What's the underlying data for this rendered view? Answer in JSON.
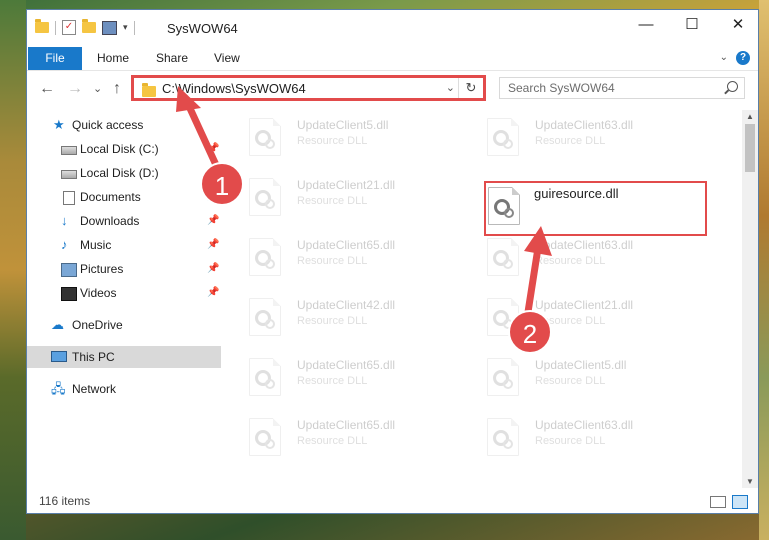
{
  "window": {
    "title": "SysWOW64",
    "controls": {
      "minimize": "—",
      "maximize": "☐",
      "close": "✕"
    }
  },
  "ribbon": {
    "file": "File",
    "tabs": [
      "Home",
      "Share",
      "View"
    ],
    "help": "?"
  },
  "nav": {
    "back": "←",
    "forward": "→",
    "recent": "⌄",
    "up": "↑",
    "address": "C:\\Windows\\SysWOW64",
    "search_placeholder": "Search SysWOW64"
  },
  "sidebar": {
    "items": [
      {
        "label": "Quick access",
        "icon": "star-icon"
      },
      {
        "label": "Local Disk (C:)",
        "icon": "disk-icon",
        "pinned": true
      },
      {
        "label": "Local Disk (D:)",
        "icon": "disk-icon",
        "pinned": true
      },
      {
        "label": "Documents",
        "icon": "document-icon",
        "pinned": true
      },
      {
        "label": "Downloads",
        "icon": "download-icon",
        "pinned": true
      },
      {
        "label": "Music",
        "icon": "music-icon",
        "pinned": true
      },
      {
        "label": "Pictures",
        "icon": "pictures-icon",
        "pinned": true
      },
      {
        "label": "Videos",
        "icon": "video-icon",
        "pinned": true
      },
      {
        "label": "OneDrive",
        "icon": "cloud-icon"
      },
      {
        "label": "This PC",
        "icon": "computer-icon",
        "selected": true
      },
      {
        "label": "Network",
        "icon": "network-icon"
      }
    ]
  },
  "files": {
    "highlighted": {
      "name": "guiresource.dll"
    },
    "left_column": [
      {
        "name": "UpdateClient5.dll",
        "desc": "Resource DLL"
      },
      {
        "name": "UpdateClient21.dll",
        "desc": "Resource DLL"
      },
      {
        "name": "UpdateClient65.dll",
        "desc": "Resource DLL"
      },
      {
        "name": "UpdateClient42.dll",
        "desc": "Resource DLL"
      },
      {
        "name": "UpdateClient65.dll",
        "desc": "Resource DLL"
      },
      {
        "name": "UpdateClient65.dll",
        "desc": "Resource DLL"
      }
    ],
    "right_column": [
      {
        "name": "UpdateClient63.dll",
        "desc": "Resource DLL"
      },
      {
        "name": "UpdateClient63.dll",
        "desc": "Resource DLL"
      },
      {
        "name": "UpdateClient21.dll",
        "desc": "Resource DLL"
      },
      {
        "name": "UpdateClient5.dll",
        "desc": "Resource DLL"
      },
      {
        "name": "UpdateClient63.dll",
        "desc": "Resource DLL"
      }
    ]
  },
  "status": {
    "item_count": "116 items"
  },
  "annotations": {
    "step1": "1",
    "step2": "2",
    "color": "#e24b4b"
  }
}
